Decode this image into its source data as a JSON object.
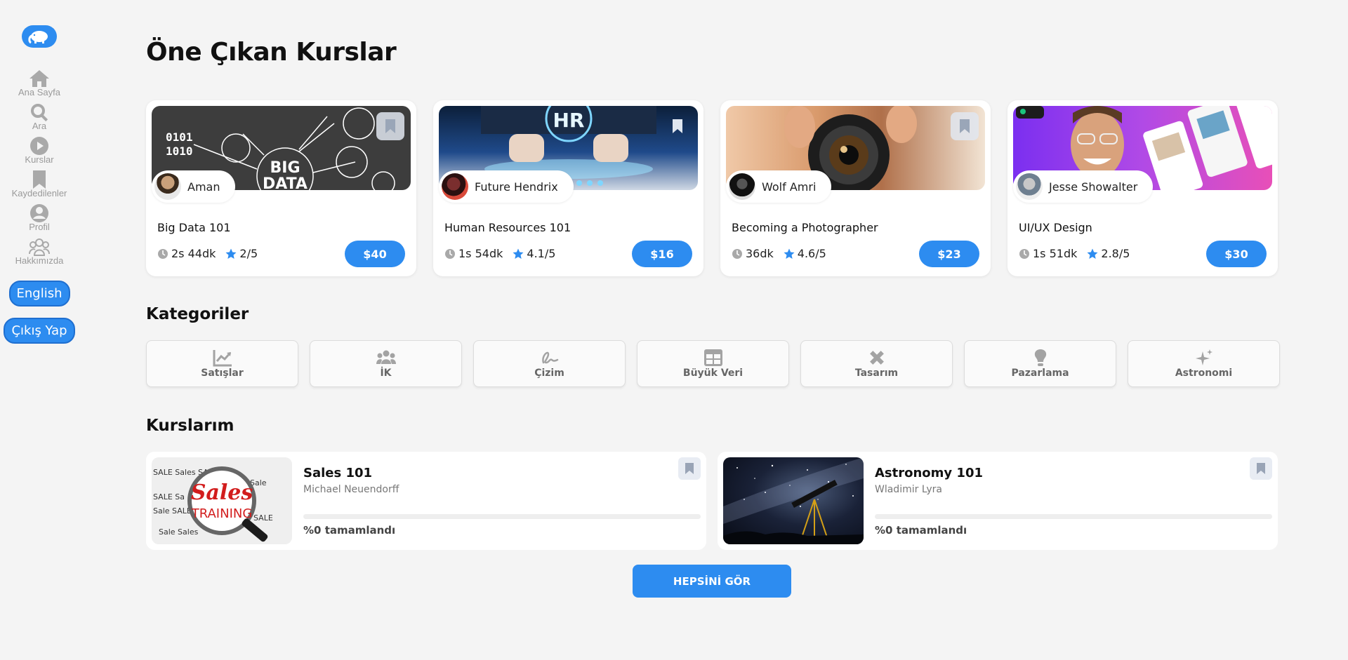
{
  "sidebar": {
    "logo_icon": "elephant-logo",
    "items": [
      {
        "label": "Ana Sayfa",
        "icon": "home-icon"
      },
      {
        "label": "Ara",
        "icon": "search-icon"
      },
      {
        "label": "Kurslar",
        "icon": "play-icon"
      },
      {
        "label": "Kaydedilenler",
        "icon": "bookmark-icon"
      },
      {
        "label": "Profil",
        "icon": "user-icon"
      },
      {
        "label": "Hakkımızda",
        "icon": "users-icon"
      }
    ],
    "language_button": "English",
    "logout_button": "Çıkış Yap"
  },
  "featured": {
    "title": "Öne Çıkan Kurslar",
    "courses": [
      {
        "title": "Big Data 101",
        "author": "Aman",
        "duration": "2s 44dk",
        "rating": "2/5",
        "price": "$40"
      },
      {
        "title": "Human Resources 101",
        "author": "Future Hendrix",
        "duration": "1s 54dk",
        "rating": "4.1/5",
        "price": "$16"
      },
      {
        "title": "Becoming a Photographer",
        "author": "Wolf Amri",
        "duration": "36dk",
        "rating": "4.6/5",
        "price": "$23"
      },
      {
        "title": "UI/UX Design",
        "author": "Jesse Showalter",
        "duration": "1s 51dk",
        "rating": "2.8/5",
        "price": "$30"
      }
    ]
  },
  "categories": {
    "title": "Kategoriler",
    "items": [
      {
        "label": "Satışlar",
        "icon": "chart-line-icon"
      },
      {
        "label": "İK",
        "icon": "people-group-icon"
      },
      {
        "label": "Çizim",
        "icon": "signature-icon"
      },
      {
        "label": "Büyük Veri",
        "icon": "table-icon"
      },
      {
        "label": "Tasarım",
        "icon": "ruler-pencil-icon"
      },
      {
        "label": "Pazarlama",
        "icon": "lightbulb-icon"
      },
      {
        "label": "Astronomi",
        "icon": "sparkles-icon"
      }
    ]
  },
  "my_courses": {
    "title": "Kurslarım",
    "items": [
      {
        "title": "Sales 101",
        "instructor": "Michael Neuendorff",
        "progress_text": "%0 tamamlandı",
        "progress": 0
      },
      {
        "title": "Astronomy 101",
        "instructor": "Wladimir Lyra",
        "progress_text": "%0 tamamlandı",
        "progress": 0
      }
    ],
    "see_all": "HEPSİNİ GÖR"
  },
  "image_text": {
    "big_data": [
      "BIG",
      "DATA"
    ],
    "big_data_binary": [
      "0101",
      "1010"
    ],
    "hr": "HR",
    "sales": "Sales",
    "training": "TRAINING"
  },
  "colors": {
    "accent": "#2d8cf0",
    "star": "#2d8cf0",
    "icon_gray": "#a3a3a3"
  }
}
